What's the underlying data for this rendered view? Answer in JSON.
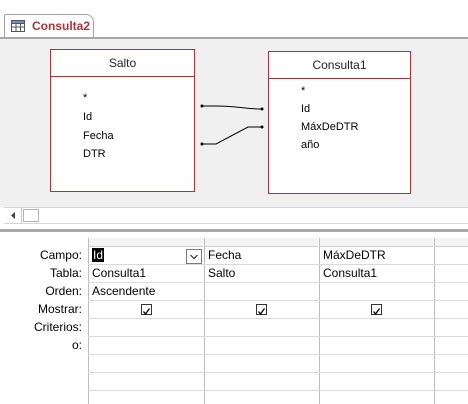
{
  "tab": {
    "label": "Consulta2",
    "icon": "query-icon"
  },
  "tables": [
    {
      "title": "Salto",
      "fields": [
        "*",
        "Id",
        "Fecha",
        "DTR"
      ]
    },
    {
      "title": "Consulta1",
      "fields": [
        "*",
        "Id",
        "MáxDeDTR",
        "año"
      ]
    }
  ],
  "grid": {
    "row_labels": [
      "Campo:",
      "Tabla:",
      "Orden:",
      "Mostrar:",
      "Criterios:",
      "o:"
    ],
    "columns": [
      {
        "campo": "Id",
        "tabla": "Consulta1",
        "orden": "Ascendente",
        "mostrar": true
      },
      {
        "campo": "Fecha",
        "tabla": "Salto",
        "orden": "",
        "mostrar": true
      },
      {
        "campo": "MáxDeDTR",
        "tabla": "Consulta1",
        "orden": "",
        "mostrar": true
      }
    ]
  },
  "colors": {
    "accent": "#a4373a",
    "designer_bg": "#f0f0f0"
  }
}
